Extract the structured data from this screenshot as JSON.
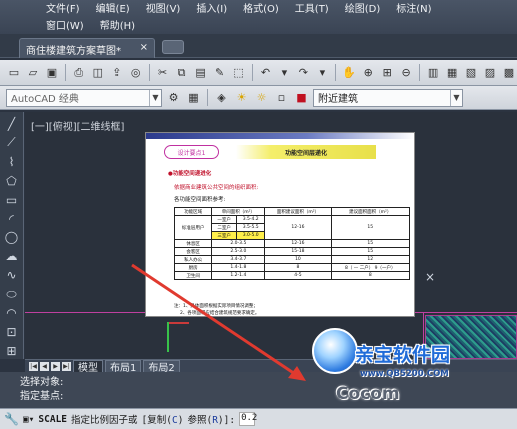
{
  "menu": {
    "row1": [
      "文件(F)",
      "编辑(E)",
      "视图(V)",
      "插入(I)",
      "格式(O)",
      "工具(T)",
      "绘图(D)",
      "标注(N)"
    ],
    "row2": [
      "窗口(W)",
      "帮助(H)"
    ]
  },
  "file_tab": {
    "title": "商住楼建筑方案草图*",
    "close": "×"
  },
  "toolbar2": {
    "workspace": "AutoCAD 经典",
    "layer": "附近建筑"
  },
  "viewport_label": "[一][俯视][二维线框]",
  "paper": {
    "pill": "设计要点1",
    "banner": "功能空间层递化",
    "heading": "●功能空间递进化",
    "subheading": "依据商业建筑公共空间的组织面积:",
    "caption": "各功能空间面积参考:",
    "table": {
      "headers": [
        "功能区域",
        "单间面积（m²）",
        "面积建议面积（m²）",
        "建议面积面积（m²）"
      ],
      "rows": [
        [
          "",
          "一室户",
          "3.5-4.2",
          "",
          ""
        ],
        [
          "标准层用户",
          "二室户",
          "3.5-5.5",
          "12-16",
          "15"
        ],
        [
          "",
          "三室户",
          "3.0-5.0",
          "",
          ""
        ],
        [
          "休息区",
          "",
          "2.0-3.5",
          "12-16",
          "15"
        ],
        [
          "会客区",
          "",
          "2.5-3.0",
          "15-18",
          "15"
        ],
        [
          "私人办公",
          "",
          "3.4-3.7",
          "10",
          "12"
        ],
        [
          "厨房",
          "",
          "1.4-1.8",
          "8",
          "8（ — 二户）\n9（一户）"
        ],
        [
          "卫生间",
          "",
          "1.2-1.4",
          "4-5",
          "8"
        ]
      ],
      "notes": [
        "注：1、具体面积根据实际项目情况调整；",
        "2、各项面积应结合建筑规范要求确定。"
      ]
    }
  },
  "layout_tabs": [
    "模型",
    "布局1",
    "布局2"
  ],
  "command_history": [
    "选择对象:",
    "指定基点:"
  ],
  "command_line": {
    "command": "SCALE",
    "prompt": "指定比例因子或",
    "opt1_pre": "[复制(",
    "opt1_key": "C",
    "opt1_post": ")",
    "opt2_pre": "参照(",
    "opt2_key": "R",
    "opt2_post": ")]:",
    "input": "0.2"
  },
  "watermark": {
    "title": "亲宝软件园",
    "url": "www.QB5200.COM",
    "big": "Cocom"
  },
  "colors": {
    "accent_arrow": "#e03a2f",
    "highlight_yellow": "#ffef4a",
    "watermark_blue": "#1f6bd8"
  }
}
